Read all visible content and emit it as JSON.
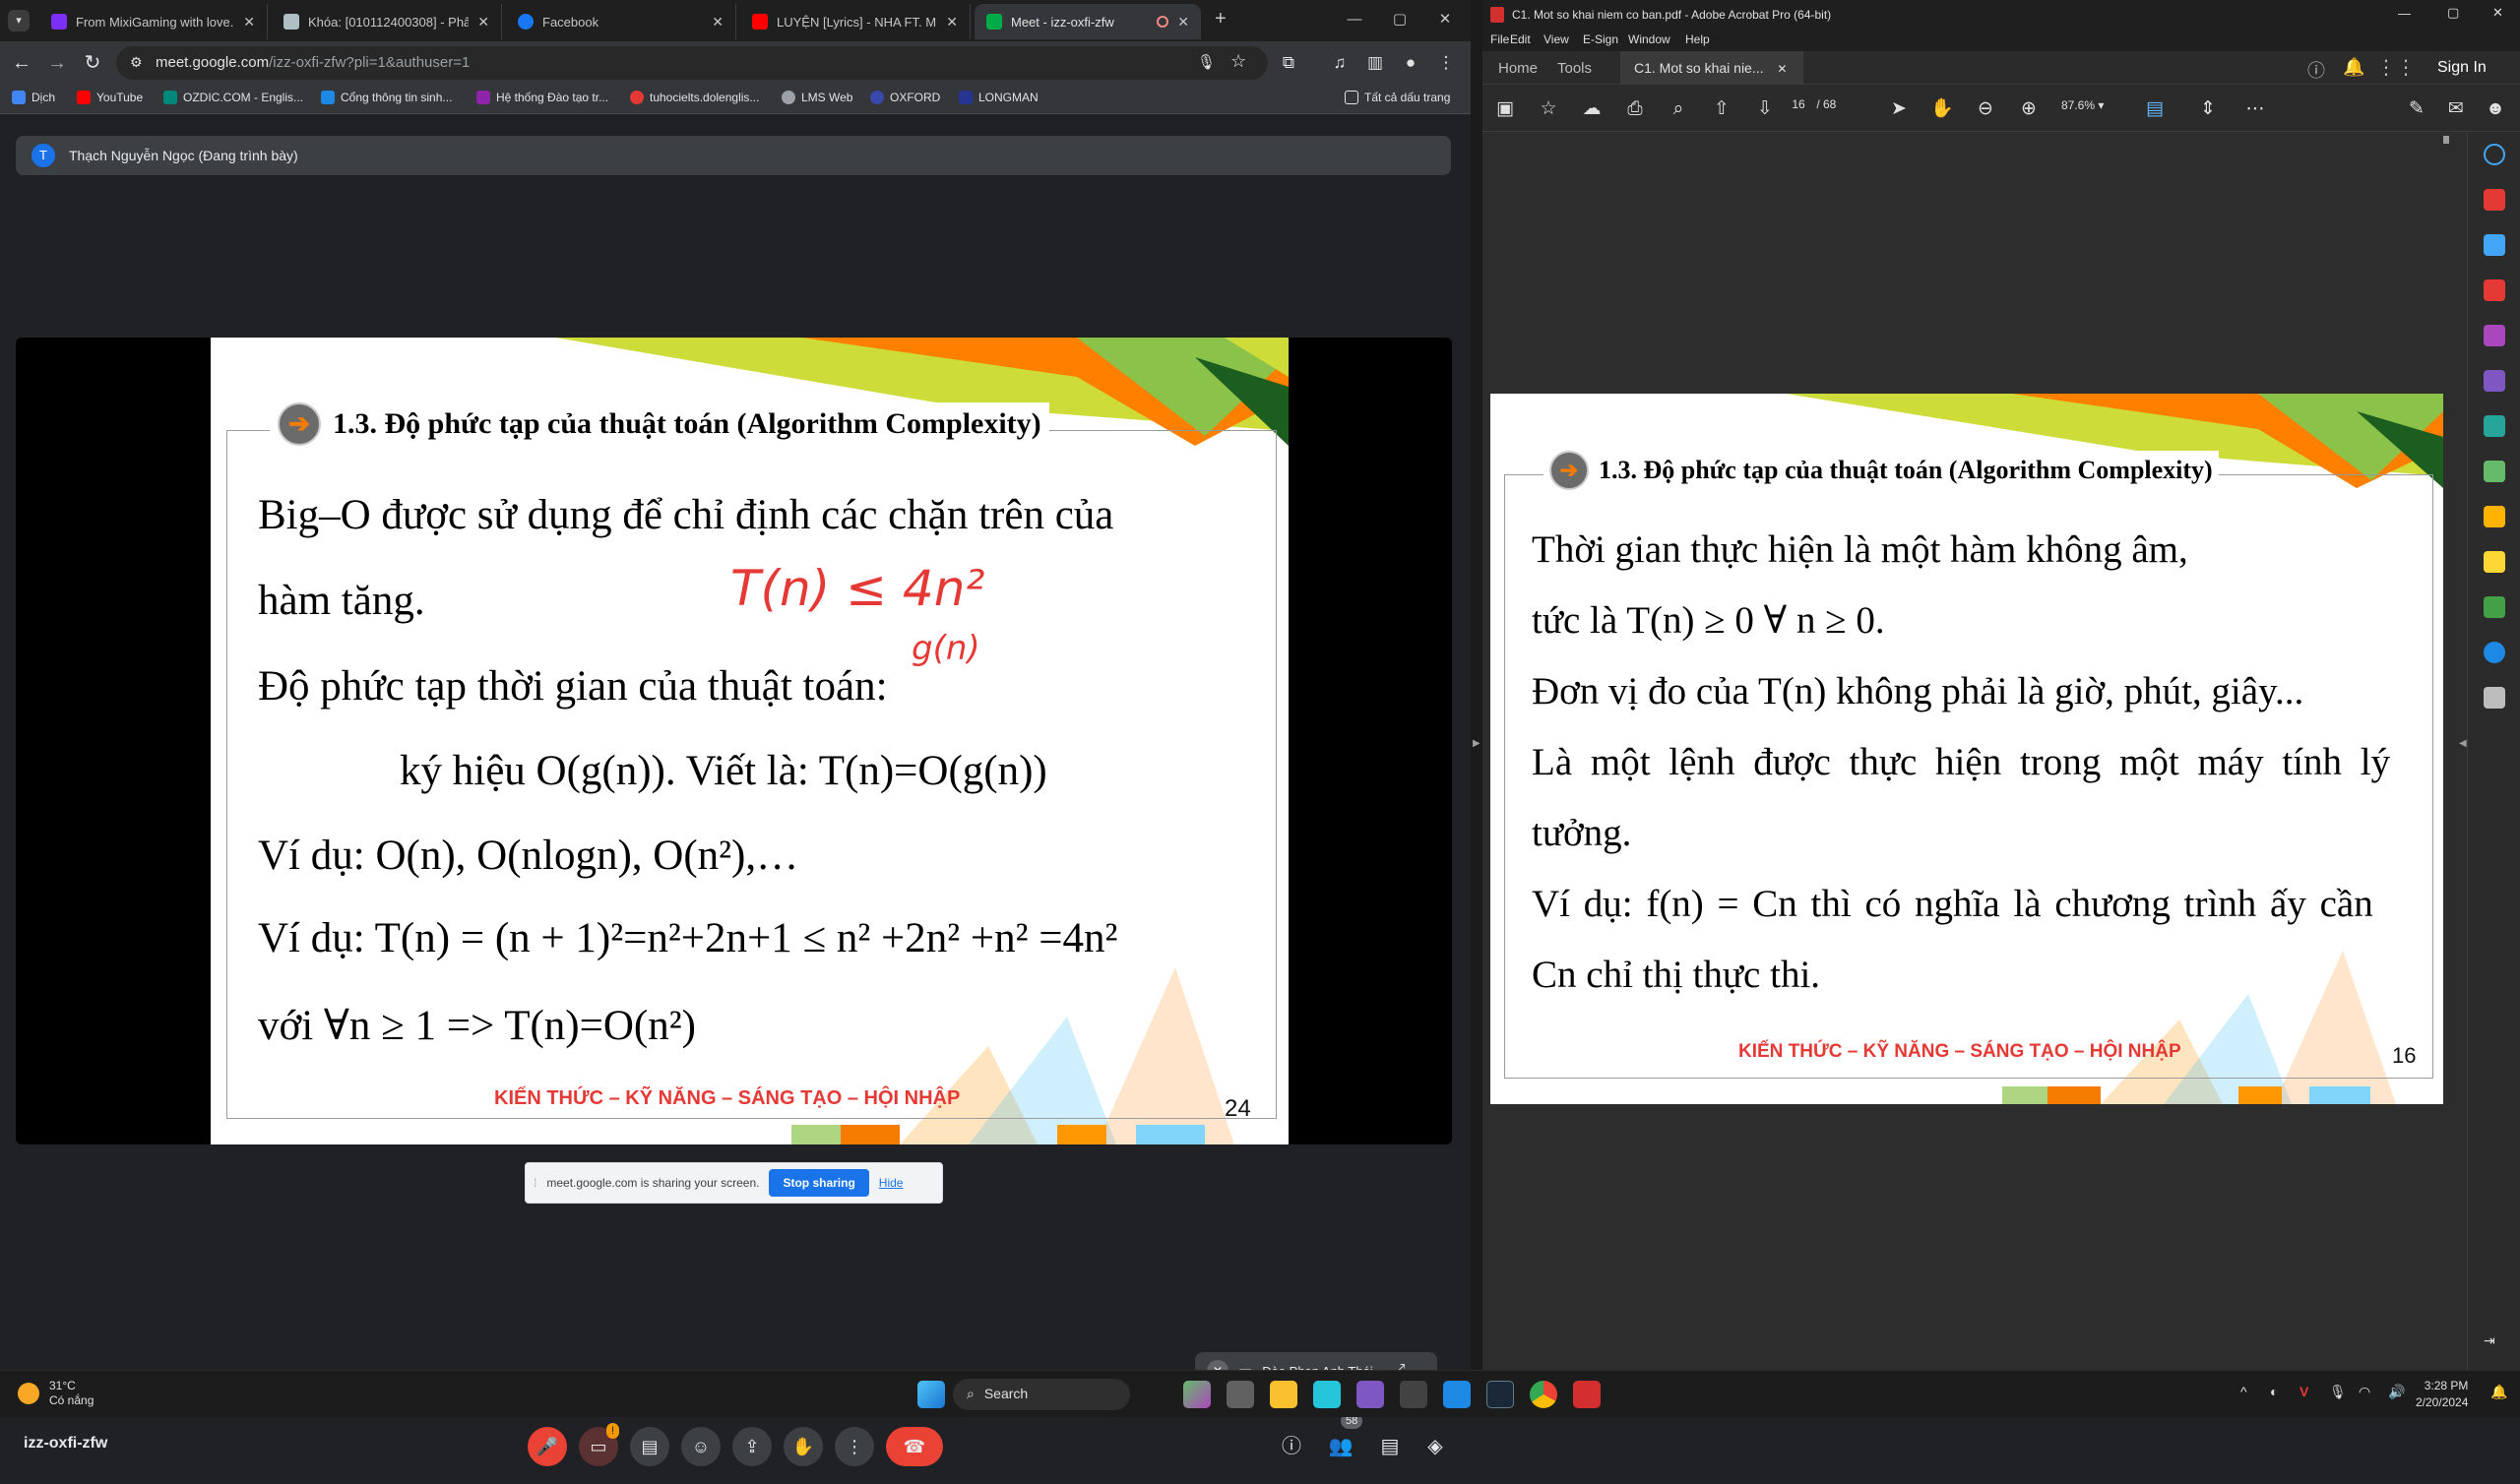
{
  "chrome": {
    "tabs": [
      {
        "title": "From MixiGaming with love... -",
        "color": "#7b2ff7"
      },
      {
        "title": "Khóa: [010112400308] - Phân t",
        "color": "#b0bec5"
      },
      {
        "title": "Facebook",
        "color": "#1877f2"
      },
      {
        "title": "LUYỆN [Lyrics] - NHA FT. MDR",
        "color": "#ff0000"
      },
      {
        "title": "Meet - izz-oxfi-zfw",
        "color": "#00ac47"
      }
    ],
    "url_main": "meet.google.com",
    "url_path": "/izz-oxfi-zfw?pli=1&authuser=1",
    "bookmarks": [
      "Dịch",
      "YouTube",
      "OZDIC.COM - Englis...",
      "Cổng thông tin sinh...",
      "Hệ thống Đào tạo tr...",
      "tuhocielts.dolenglis...",
      "LMS Web",
      "OXFORD",
      "LONGMAN"
    ],
    "all_bookmarks": "Tất cả dấu trang"
  },
  "meet": {
    "avatar_letter": "T",
    "presenter": "Thạch Nguyễn Ngọc (Đang trình bày)",
    "share_notice": "meet.google.com is sharing your screen.",
    "stop_sharing": "Stop sharing",
    "hide": "Hide",
    "self_name": "Đào Phan Anh Thái",
    "meeting_code": "izz-oxfi-zfw",
    "camera_badge": "!",
    "participants_badge": "58"
  },
  "slide_meet": {
    "heading": "1.3. Độ phức tạp của thuật toán (Algorithm Complexity)",
    "lines": [
      "Big–O được sử dụng để chỉ định các chặn trên của",
      "hàm tăng.",
      "Độ phức tạp thời gian của thuật toán:",
      "ký hiệu O(g(n)). Viết là: T(n)=O(g(n))",
      "Ví dụ: O(n), O(nlogn), O(n²),…",
      "Ví dụ: T(n) = (n + 1)²=n²+2n+1 ≤ n² +2n² +n² =4n²",
      "với ∀n ≥  1 => T(n)=O(n²)"
    ],
    "annotation_1": "T(n) ≤ 4n²",
    "annotation_2": "g(n)",
    "footer": "KIẾN THỨC – KỸ NĂNG – SÁNG TẠO – HỘI NHẬP",
    "page": "24"
  },
  "acrobat": {
    "title": "C1. Mot so khai niem co ban.pdf - Adobe Acrobat Pro (64-bit)",
    "menu": [
      "File",
      "Edit",
      "View",
      "E-Sign",
      "Window",
      "Help"
    ],
    "tab_home": "Home",
    "tab_tools": "Tools",
    "doc_tab": "C1. Mot so khai nie...",
    "sign_in": "Sign In",
    "page_current": "16",
    "page_total": "/  68",
    "zoom": "87.6%"
  },
  "slide_pdf": {
    "heading": "1.3. Độ phức tạp của thuật toán (Algorithm Complexity)",
    "lines": [
      "Thời gian thực hiện là một hàm không âm,",
      "tức là T(n) ≥ 0 ∀ n ≥ 0.",
      "Đơn vị đo của T(n) không phải là giờ, phút, giây...",
      "Là một lệnh được thực hiện trong một máy tính lý",
      "tưởng.",
      "Ví dụ: f(n) = Cn thì có nghĩa là chương trình ấy cần",
      "Cn chỉ thị thực thi."
    ],
    "footer": "KIẾN THỨC – KỸ NĂNG – SÁNG TẠO – HỘI NHẬP",
    "page": "16"
  },
  "taskbar": {
    "temp": "31°C",
    "weather": "Có nắng",
    "search": "Search",
    "time": "3:28 PM",
    "date": "2/20/2024"
  }
}
